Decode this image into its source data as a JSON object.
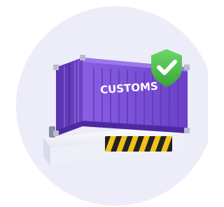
{
  "illustration": {
    "container_label": "CUSTOMS",
    "badge_icon": "shield-check-icon",
    "colors": {
      "background_circle": "#ecedf8",
      "container_purple": "#7b4fd6",
      "container_dark": "#5a33b0",
      "container_light": "#9670e6",
      "platform": "#f2f2f8",
      "platform_shadow": "#c9cbe2",
      "shield_green": "#4cbe4a",
      "stripe_yellow": "#f2c21a",
      "stripe_black": "#222222"
    }
  }
}
